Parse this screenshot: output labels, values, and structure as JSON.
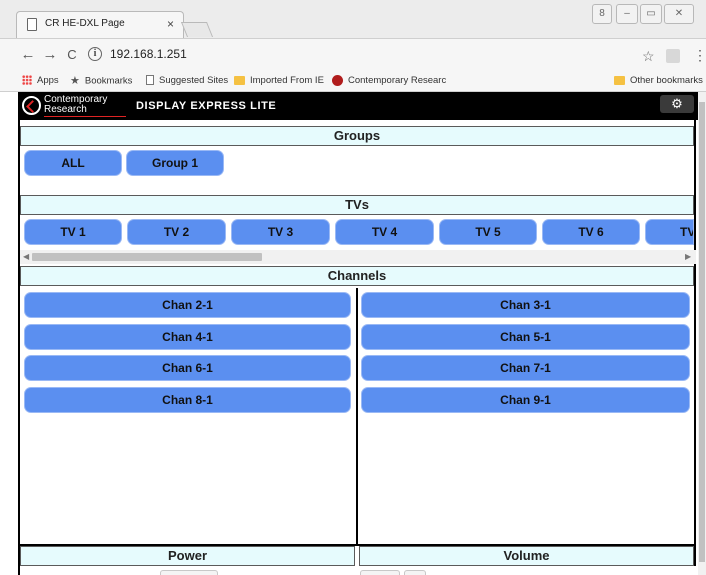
{
  "browser": {
    "tab_title": "CR HE-DXL Page",
    "tab_close": "×",
    "url": "192.168.1.251",
    "info_symbol": "i",
    "back": "←",
    "forward": "→",
    "reload": "C",
    "star": "☆",
    "menu": "⋮",
    "window_controls": [
      "8",
      "–",
      "▭",
      "✕"
    ],
    "bookmarks": [
      {
        "label": "Apps",
        "icon": "apps-icon"
      },
      {
        "label": "Bookmarks",
        "icon": "star-icon"
      },
      {
        "label": "Suggested Sites",
        "icon": "page-icon"
      },
      {
        "label": "Imported From IE",
        "icon": "folder-icon"
      },
      {
        "label": "Contemporary Researc",
        "icon": "contemporary-research-icon"
      }
    ],
    "other_bookmarks": "Other bookmarks"
  },
  "app": {
    "brand_line1": "Contemporary",
    "brand_line2": "Research",
    "title": "DISPLAY EXPRESS LITE",
    "settings_icon": "⚙"
  },
  "groups": {
    "header": "Groups",
    "items": [
      "ALL",
      "Group 1"
    ]
  },
  "tvs": {
    "header": "TVs",
    "items": [
      "TV 1",
      "TV 2",
      "TV 3",
      "TV 4",
      "TV 5",
      "TV 6",
      "TV"
    ]
  },
  "channels": {
    "header": "Channels",
    "left": [
      "Chan 2-1",
      "Chan 4-1",
      "Chan 6-1",
      "Chan 8-1"
    ],
    "right": [
      "Chan 3-1",
      "Chan 5-1",
      "Chan 7-1",
      "Chan 9-1"
    ]
  },
  "power": {
    "header": "Power"
  },
  "volume": {
    "header": "Volume"
  }
}
